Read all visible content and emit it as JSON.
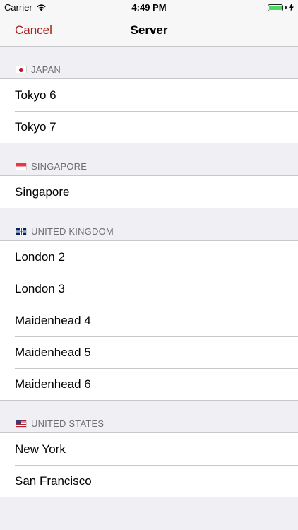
{
  "status_bar": {
    "carrier": "Carrier",
    "time": "4:49 PM",
    "battery_level": 1.0
  },
  "nav": {
    "cancel_label": "Cancel",
    "title": "Server"
  },
  "colors": {
    "accent": "#a8201a",
    "background": "#efeff4",
    "separator": "#c8c7cc",
    "header_text": "#6d6d72"
  },
  "sections": [
    {
      "flag": "japan-flag-icon",
      "header": "JAPAN",
      "rows": [
        "Tokyo 6",
        "Tokyo 7"
      ]
    },
    {
      "flag": "singapore-flag-icon",
      "header": "SINGAPORE",
      "rows": [
        "Singapore"
      ]
    },
    {
      "flag": "uk-flag-icon",
      "header": "UNITED KINGDOM",
      "rows": [
        "London 2",
        "London 3",
        "Maidenhead 4",
        "Maidenhead 5",
        "Maidenhead 6"
      ]
    },
    {
      "flag": "us-flag-icon",
      "header": "UNITED STATES",
      "rows": [
        "New York",
        "San Francisco"
      ]
    }
  ]
}
